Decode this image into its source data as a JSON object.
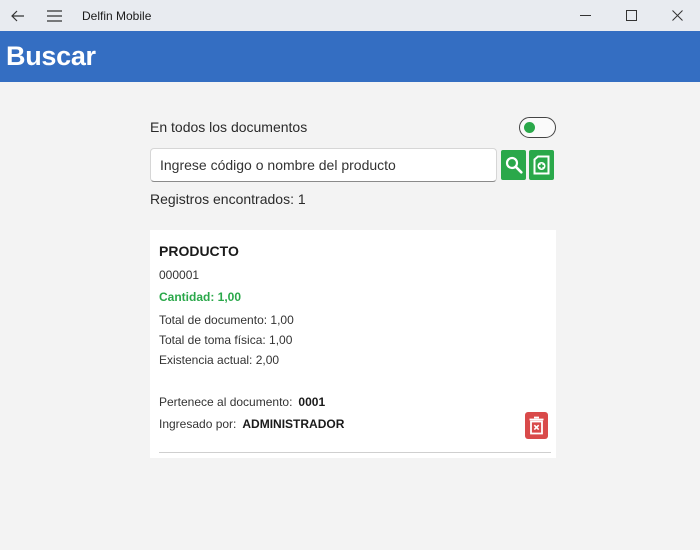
{
  "window": {
    "title": "Delfin Mobile"
  },
  "header": {
    "title": "Buscar"
  },
  "search": {
    "toggle_label": "En todos los documentos",
    "toggle_on": true,
    "placeholder": "Ingrese código o nombre del producto",
    "records_text": "Registros encontrados: 1"
  },
  "result": {
    "title": "PRODUCTO",
    "code": "000001",
    "quantity": "Cantidad: 1,00",
    "document_total": "Total de documento: 1,00",
    "physical_total": "Total de toma física: 1,00",
    "current_stock": "Existencia actual: 2,00",
    "document_label": "Pertenece al documento:",
    "document_value": "0001",
    "user_label": "Ingresado por:",
    "user_value": "ADMINISTRADOR"
  },
  "colors": {
    "header_blue": "#346ec2",
    "accent_green": "#2aa84a",
    "delete_red": "#d94a4a"
  },
  "icons": {
    "back": "arrow-left-icon",
    "menu": "hamburger-menu-icon",
    "search": "magnifier-icon",
    "add": "add-document-icon",
    "delete": "trash-icon"
  }
}
